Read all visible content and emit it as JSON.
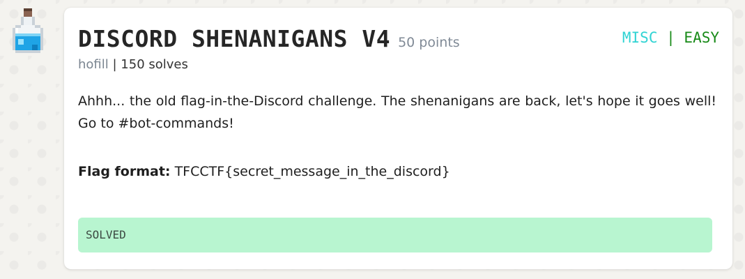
{
  "challenge": {
    "title": "DISCORD SHENANIGANS V4",
    "points": "50 points",
    "category": "MISC",
    "separator": "|",
    "difficulty": "EASY",
    "author": "hofill",
    "meta_separator": "|",
    "solves": "150 solves",
    "description": "Ahhh... the old flag-in-the-Discord challenge. The shenanigans are back, let's hope it goes well! Go to #bot-commands!",
    "flag_label": "Flag format:",
    "flag_value": "TFCCTF{secret_message_in_the_discord}",
    "status": "SOLVED"
  },
  "colors": {
    "category": "#2fd3d3",
    "difficulty": "#178a17",
    "solved_bg": "#b8f5d0"
  },
  "icons": {
    "challenge_icon": "potion-bottle-icon"
  }
}
